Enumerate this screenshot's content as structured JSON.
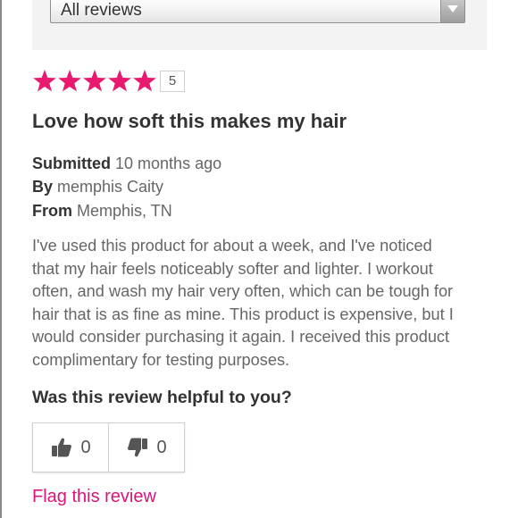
{
  "filter": {
    "selected": "All reviews"
  },
  "review": {
    "rating": 5,
    "rating_max": 5,
    "rating_label": "5",
    "star_color": "#e8196e",
    "title": "Love how soft this makes my hair",
    "submitted_label": "Submitted",
    "submitted_value": "10 months ago",
    "by_label": "By",
    "by_value": "memphis Caity",
    "from_label": "From",
    "from_value": "Memphis, TN",
    "body_lines": [
      "I've used this product for about a week, and I've noticed",
      "that my hair feels noticeably softer and lighter. I workout",
      "often, and wash my hair very often, which can be tough for",
      "hair that is as fine as mine. This product is expensive, but I",
      "would consider purchasing it again. I received this product",
      "complimentary for testing purposes."
    ]
  },
  "helpfulness": {
    "question": "Was this review helpful to you?",
    "up_icon": "thumbs-up-icon",
    "up_count": "0",
    "down_icon": "thumbs-down-icon",
    "down_count": "0"
  },
  "flag": {
    "label": "Flag this review",
    "color": "#d8147a"
  }
}
